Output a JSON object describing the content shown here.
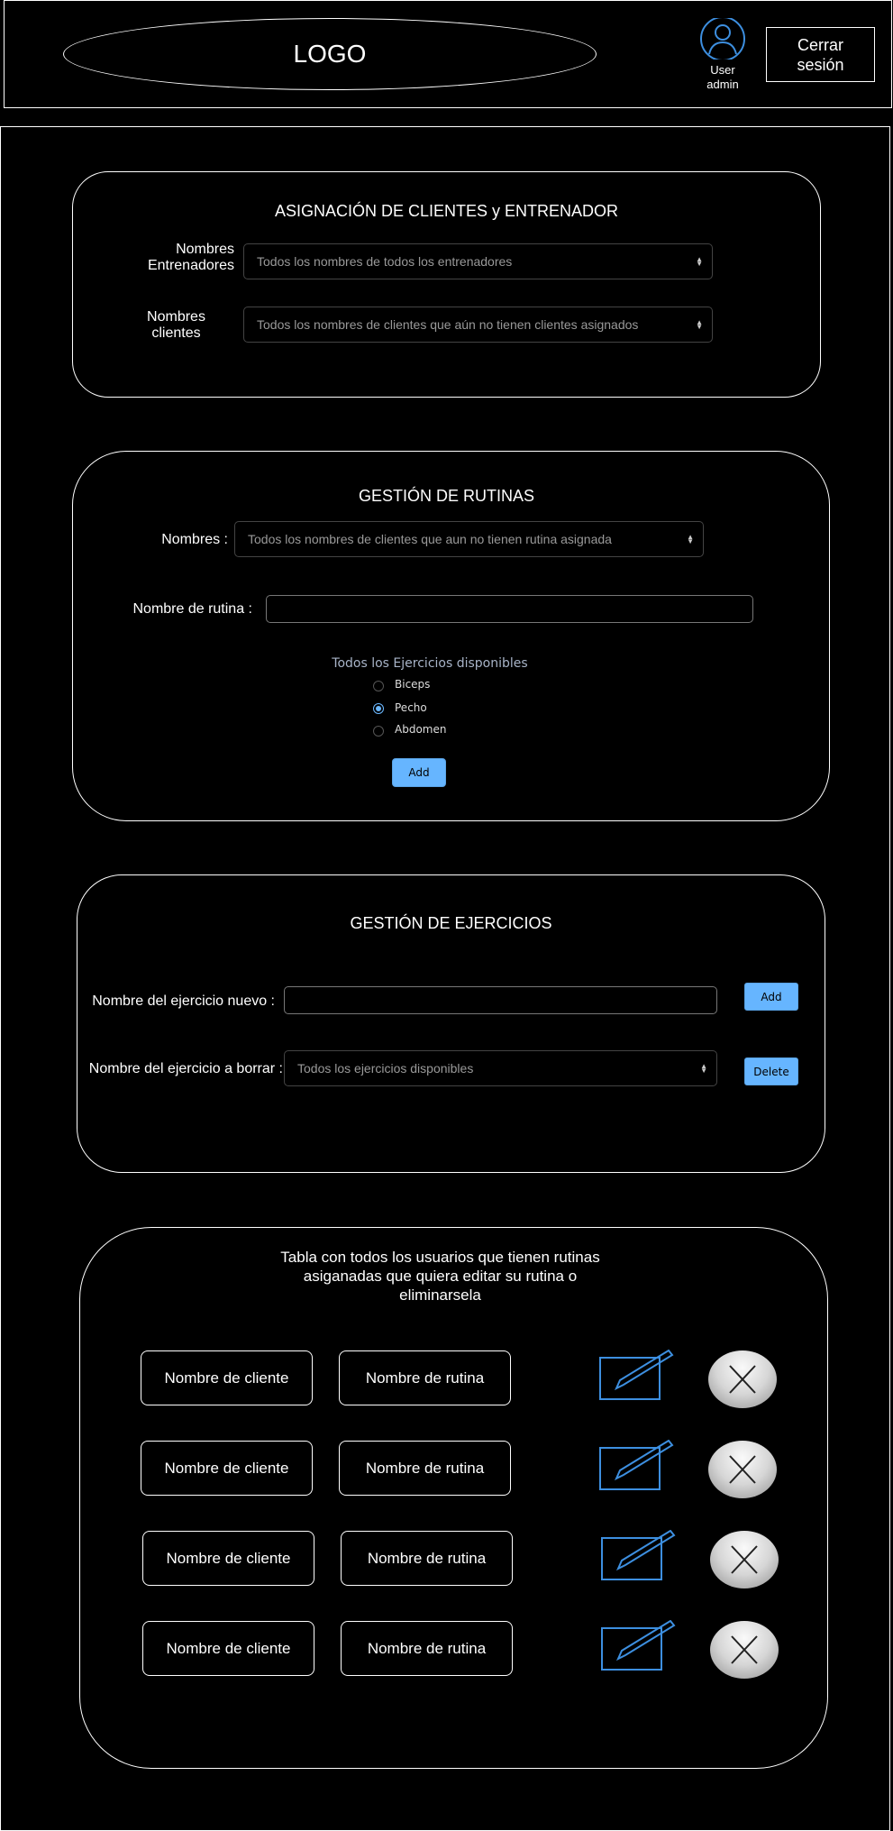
{
  "header": {
    "logo_text": "LOGO",
    "user_label": "User\nadmin",
    "logout_label": "Cerrar\nsesión"
  },
  "assign_section": {
    "title": "ASIGNACIÓN DE CLIENTES y ENTRENADOR",
    "trainers_label": "Nombres\nEntrenadores",
    "trainers_select": "Todos los nombres de todos los entrenadores",
    "clients_label": "Nombres\nclientes",
    "clients_select": "Todos los nombres de clientes que aún no tienen clientes asignados"
  },
  "routines_section": {
    "title": "GESTIÓN DE RUTINAS",
    "names_label": "Nombres :",
    "names_select": "Todos los nombres de clientes que aun no tienen rutina asignada",
    "routine_name_label": "Nombre de rutina :",
    "routine_name_value": "",
    "exercises_heading": "Todos los Ejercicios disponibles",
    "exercises": [
      {
        "label": "Biceps",
        "checked": false
      },
      {
        "label": "Pecho",
        "checked": true
      },
      {
        "label": "Abdomen",
        "checked": false
      }
    ],
    "add_label": "Add"
  },
  "exercises_section": {
    "title": "GESTIÓN DE EJERCICIOS",
    "new_label": "Nombre del ejercicio nuevo :",
    "new_value": "",
    "add_label": "Add",
    "delete_label": "Nombre del ejercicio a borrar :",
    "delete_select": "Todos los ejercicios disponibles",
    "delete_button": "Delete"
  },
  "table_section": {
    "title": "Tabla con todos los usuarios que tienen rutinas asiganadas que quiera editar su rutina o eliminarsela",
    "rows": [
      {
        "client": "Nombre de cliente",
        "routine": "Nombre de rutina"
      },
      {
        "client": "Nombre de cliente",
        "routine": "Nombre de rutina"
      },
      {
        "client": "Nombre de cliente",
        "routine": "Nombre de rutina"
      },
      {
        "client": "Nombre de cliente",
        "routine": "Nombre de rutina"
      }
    ]
  },
  "colors": {
    "background": "#000000",
    "accent_blue": "#3d8fe0",
    "button_blue": "#66b5ff"
  },
  "icons": {
    "user": "user-icon",
    "edit": "edit-icon",
    "delete": "close-icon",
    "select_arrow": "chevron-up-down-icon"
  }
}
